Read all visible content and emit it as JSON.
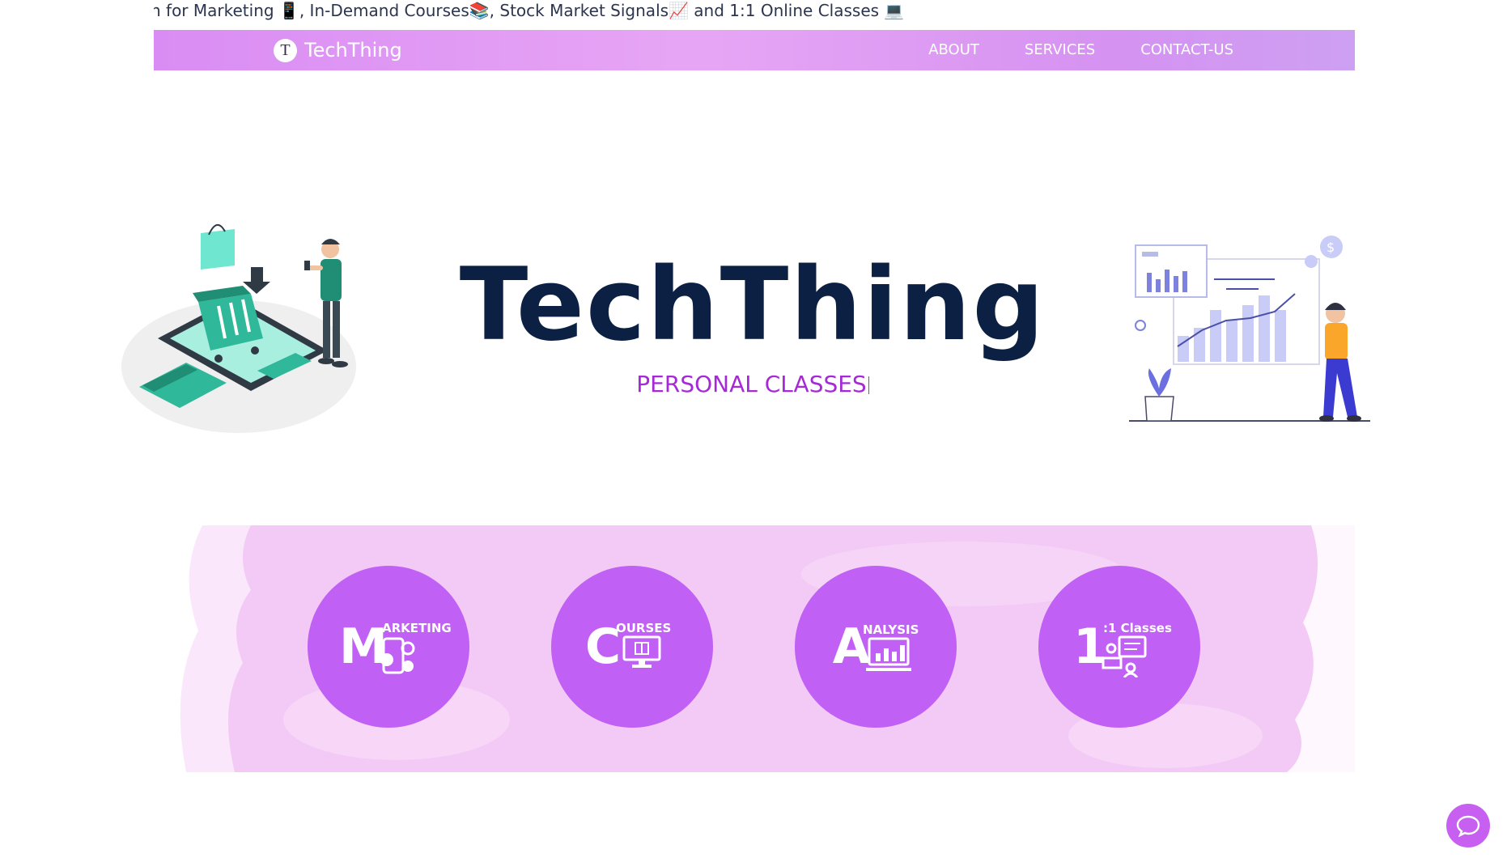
{
  "marquee": {
    "text": "n for Marketing 📱, In-Demand Courses📚, Stock Market Signals📈  and 1:1 Online Classes 💻"
  },
  "navbar": {
    "logo_letter": "T",
    "brand": "TechThing",
    "links": [
      "ABOUT",
      "SERVICES",
      "CONTACT-US"
    ]
  },
  "hero": {
    "title": "TechThing",
    "subtitle": "PERSONAL CLASSES"
  },
  "services": [
    {
      "big": "M",
      "small": "ARKETING",
      "icon": "social-media-phone-icon"
    },
    {
      "big": "C",
      "small": "OURSES",
      "icon": "monitor-book-icon"
    },
    {
      "big": "A",
      "small": "NALYSIS",
      "icon": "bar-chart-monitor-icon"
    },
    {
      "big": "1",
      "small": ":1 Classes",
      "icon": "teacher-presentation-icon"
    }
  ],
  "colors": {
    "accent": "#c160f4",
    "nav_gradient": "#d98cf3",
    "title": "#0b2042",
    "subtitle": "#a52ad6",
    "band": "#f3c9f5"
  },
  "chat": {
    "icon": "chat-bubble-icon"
  }
}
